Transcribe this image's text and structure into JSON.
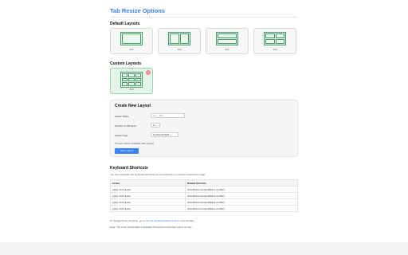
{
  "title": "Tab Resize Options",
  "default_layouts": {
    "heading": "Default Layouts",
    "items": [
      {
        "label": "1x1"
      },
      {
        "label": "1x2"
      },
      {
        "label": "2x1"
      },
      {
        "label": "2x2"
      }
    ]
  },
  "custom_layouts": {
    "heading": "Custom Layouts",
    "items": [
      {
        "label": "3x3",
        "delete_icon": "×"
      }
    ]
  },
  "create": {
    "heading": "Create New Layout",
    "name_label": "Layout Name",
    "name_placeholder": "e.g., \"3x1\"",
    "windows_label": "Number of Windows",
    "windows_value": "2",
    "type_label": "Layout Type",
    "type_value": "Horizontal Split",
    "preview_note": "Preview will be available after saving",
    "save_label": "Save Layout"
  },
  "shortcuts": {
    "heading": "Keyboard Shortcuts",
    "intro": "You can customize the keyboard shortcuts for this extension in Chrome's extensions page.",
    "columns": [
      "Action",
      "Default Shortcut"
    ],
    "rows": [
      [
        "Apply 1x1 Layout",
        "Ctrl+Shift+1 (Cmd+Shift+1 on Mac)"
      ],
      [
        "Apply 1x2 Layout",
        "Ctrl+Shift+2 (Cmd+Shift+2 on Mac)"
      ],
      [
        "Apply 2x1 Layout",
        "Ctrl+Shift+3 (Cmd+Shift+3 on Mac)"
      ],
      [
        "Apply 2x2 Layout",
        "Ctrl+Shift+4 (Cmd+Shift+4 on Mac)"
      ]
    ],
    "change_prefix": "To change these shortcuts, go to",
    "change_link": "chrome://extensions/shortcuts",
    "change_suffix": "in your browser.",
    "undo_note": "Note: The Undo functionality is available through the extension popup UI only."
  },
  "colors": {
    "accent": "#3b82f6",
    "layout_border": "#4a9a6a",
    "layout_fill": "#dff2e6",
    "delete": "#f28b8b"
  }
}
